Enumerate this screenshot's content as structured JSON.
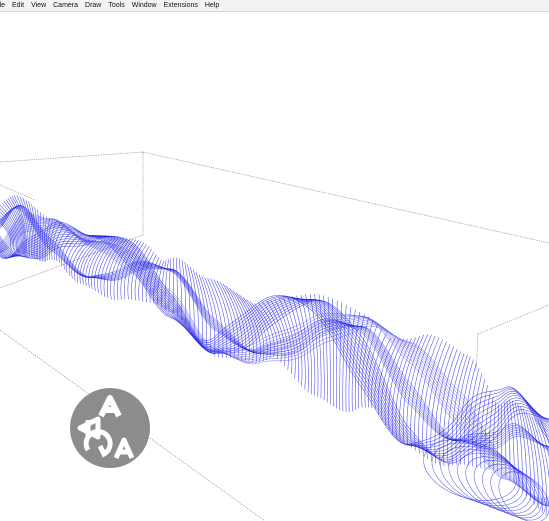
{
  "menu": [
    {
      "label": "ile"
    },
    {
      "label": "Edit"
    },
    {
      "label": "View"
    },
    {
      "label": "Camera"
    },
    {
      "label": "Draw"
    },
    {
      "label": "Tools"
    },
    {
      "label": "Window"
    },
    {
      "label": "Extensions"
    },
    {
      "label": "Help"
    }
  ],
  "colors": {
    "mesh": "#1a1ae6",
    "mesh_light": "#4a4aef",
    "bounding_box": "#7f7f7f",
    "background": "#ffffff",
    "logo_fill": "#8c8c8c"
  },
  "icons": {
    "watermark": "aaga-logo-icon"
  }
}
